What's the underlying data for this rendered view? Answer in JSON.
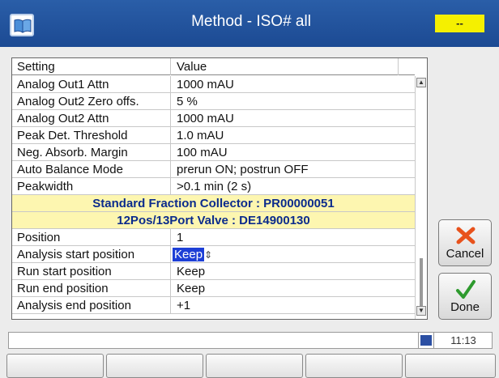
{
  "window": {
    "title": "Method - ISO# all",
    "status_badge": "--",
    "app_icon": "book-icon"
  },
  "table": {
    "headers": {
      "setting": "Setting",
      "value": "Value"
    },
    "rows": [
      {
        "setting": "Analog Out1 Attn",
        "value": "1000 mAU"
      },
      {
        "setting": "Analog Out2 Zero offs.",
        "value": "5 %"
      },
      {
        "setting": "Analog Out2 Attn",
        "value": "1000 mAU"
      },
      {
        "setting": "Peak Det. Threshold",
        "value": "1.0 mAU"
      },
      {
        "setting": "Neg. Absorb. Margin",
        "value": "100 mAU"
      },
      {
        "setting": "Auto Balance Mode",
        "value": "prerun ON; postrun OFF"
      },
      {
        "setting": "Peakwidth",
        "value": ">0.1 min (2 s)"
      }
    ],
    "sections": [
      "Standard Fraction Collector : PR00000051",
      "12Pos/13Port Valve : DE14900130"
    ],
    "rows2": [
      {
        "setting": "Position",
        "value": "1"
      },
      {
        "setting": "Analysis start position",
        "value": "Keep"
      },
      {
        "setting": "Run start position",
        "value": "Keep"
      },
      {
        "setting": "Run end position",
        "value": "Keep"
      },
      {
        "setting": "Analysis end position",
        "value": "+1"
      }
    ],
    "spinner_glyph": "⇕"
  },
  "buttons": {
    "cancel": "Cancel",
    "done": "Done"
  },
  "statusbar": {
    "message": "",
    "time": "11:13"
  },
  "colors": {
    "titlebar": "#1c4a93",
    "section_bg": "#fdf6b0",
    "section_text": "#0b2b8c",
    "selection": "#1d3fd6",
    "badge": "#f5f000",
    "cancel_icon": "#e8521c",
    "done_icon": "#2e9a2e"
  }
}
